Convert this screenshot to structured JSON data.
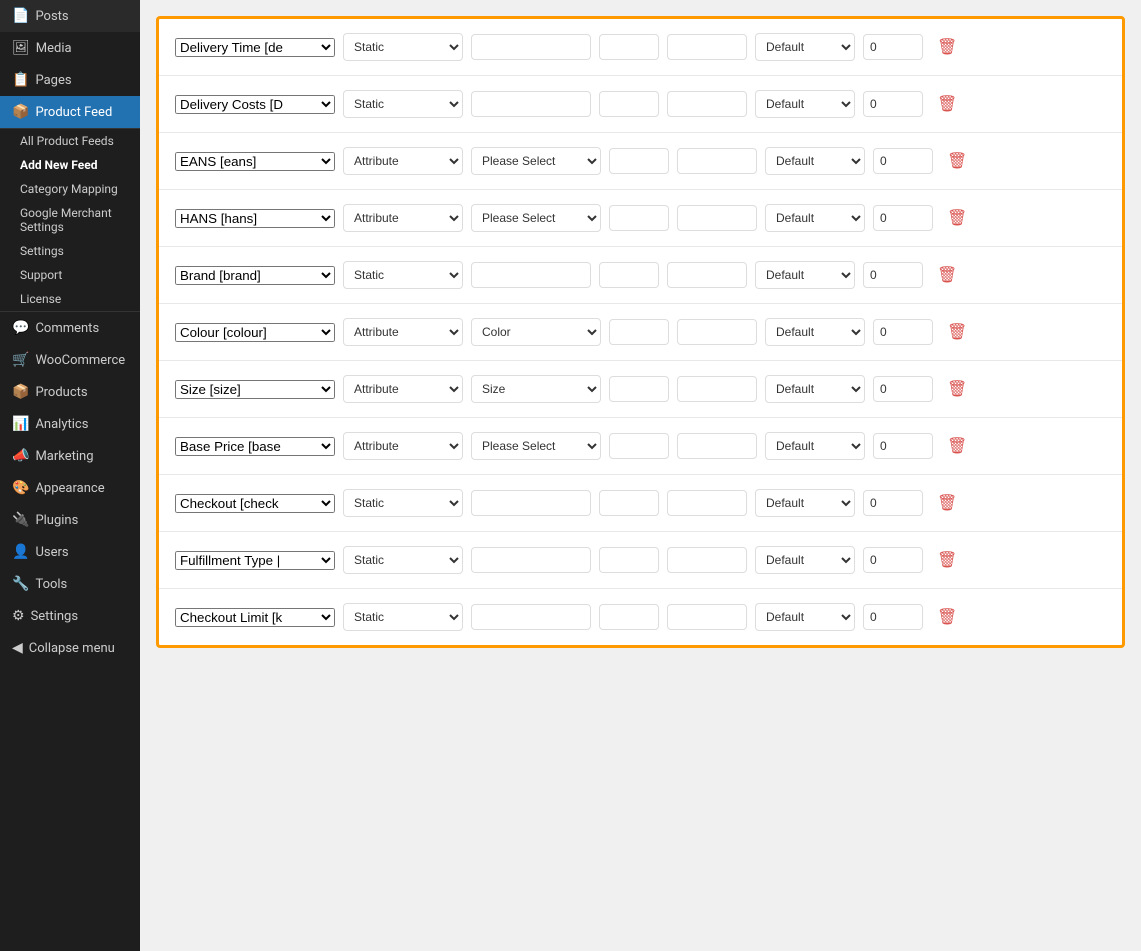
{
  "sidebar": {
    "items": [
      {
        "label": "Posts",
        "icon": "📄",
        "active": false
      },
      {
        "label": "Media",
        "icon": "🖼",
        "active": false
      },
      {
        "label": "Pages",
        "icon": "📋",
        "active": false
      },
      {
        "label": "Product Feed",
        "icon": "📦",
        "active": true
      }
    ],
    "product_feed_sub": [
      {
        "label": "All Product Feeds",
        "bold": false
      },
      {
        "label": "Add New Feed",
        "bold": true
      },
      {
        "label": "Category Mapping",
        "bold": false
      },
      {
        "label": "Google Merchant Settings",
        "bold": false
      },
      {
        "label": "Settings",
        "bold": false
      },
      {
        "label": "Support",
        "bold": false
      },
      {
        "label": "License",
        "bold": false
      }
    ],
    "items2": [
      {
        "label": "Comments",
        "icon": "💬"
      },
      {
        "label": "WooCommerce",
        "icon": "🛒"
      },
      {
        "label": "Products",
        "icon": "📦"
      },
      {
        "label": "Analytics",
        "icon": "📊"
      },
      {
        "label": "Marketing",
        "icon": "📣"
      },
      {
        "label": "Appearance",
        "icon": "🎨"
      },
      {
        "label": "Plugins",
        "icon": "🔌"
      },
      {
        "label": "Users",
        "icon": "👤"
      },
      {
        "label": "Tools",
        "icon": "🔧"
      },
      {
        "label": "Settings",
        "icon": "⚙"
      },
      {
        "label": "Collapse menu",
        "icon": "◀"
      }
    ]
  },
  "rows": [
    {
      "id": "row1",
      "field": "Delivery Time [de",
      "type": "Static",
      "attr": "",
      "input1": "",
      "input2": "",
      "default": "Default",
      "num": "0",
      "has_attr": false
    },
    {
      "id": "row2",
      "field": "Delivery Costs [D",
      "type": "Static",
      "attr": "",
      "input1": "",
      "input2": "",
      "default": "Default",
      "num": "0",
      "has_attr": false
    },
    {
      "id": "row3",
      "field": "EANS [eans]",
      "type": "Attribute",
      "attr": "Please Select",
      "input1": "",
      "input2": "",
      "default": "Default",
      "num": "0",
      "has_attr": true
    },
    {
      "id": "row4",
      "field": "HANS [hans]",
      "type": "Attribute",
      "attr": "Please Select",
      "input1": "",
      "input2": "",
      "default": "Default",
      "num": "0",
      "has_attr": true
    },
    {
      "id": "row5",
      "field": "Brand [brand]",
      "type": "Static",
      "attr": "",
      "input1": "",
      "input2": "",
      "default": "Default",
      "num": "0",
      "has_attr": false
    },
    {
      "id": "row6",
      "field": "Colour [colour]",
      "type": "Attribute",
      "attr": "Color",
      "input1": "",
      "input2": "",
      "default": "Default",
      "num": "0",
      "has_attr": true
    },
    {
      "id": "row7",
      "field": "Size [size]",
      "type": "Attribute",
      "attr": "Size",
      "input1": "",
      "input2": "",
      "default": "Default",
      "num": "0",
      "has_attr": true
    },
    {
      "id": "row8",
      "field": "Base Price [base",
      "type": "Attribute",
      "attr": "Please Select",
      "input1": "",
      "input2": "",
      "default": "Default",
      "num": "0",
      "has_attr": true
    },
    {
      "id": "row9",
      "field": "Checkout [check",
      "type": "Static",
      "attr": "",
      "input1": "",
      "input2": "",
      "default": "Default",
      "num": "0",
      "has_attr": false
    },
    {
      "id": "row10",
      "field": "Fulfillment Type |",
      "type": "Static",
      "attr": "",
      "input1": "",
      "input2": "",
      "default": "Default",
      "num": "0",
      "has_attr": false
    },
    {
      "id": "row11",
      "field": "Checkout Limit [k",
      "type": "Static",
      "attr": "",
      "input1": "",
      "input2": "",
      "default": "Default",
      "num": "0",
      "has_attr": false
    }
  ],
  "colors": {
    "border": "#f90",
    "delete": "#d9534f",
    "active_bg": "#2271b1"
  }
}
